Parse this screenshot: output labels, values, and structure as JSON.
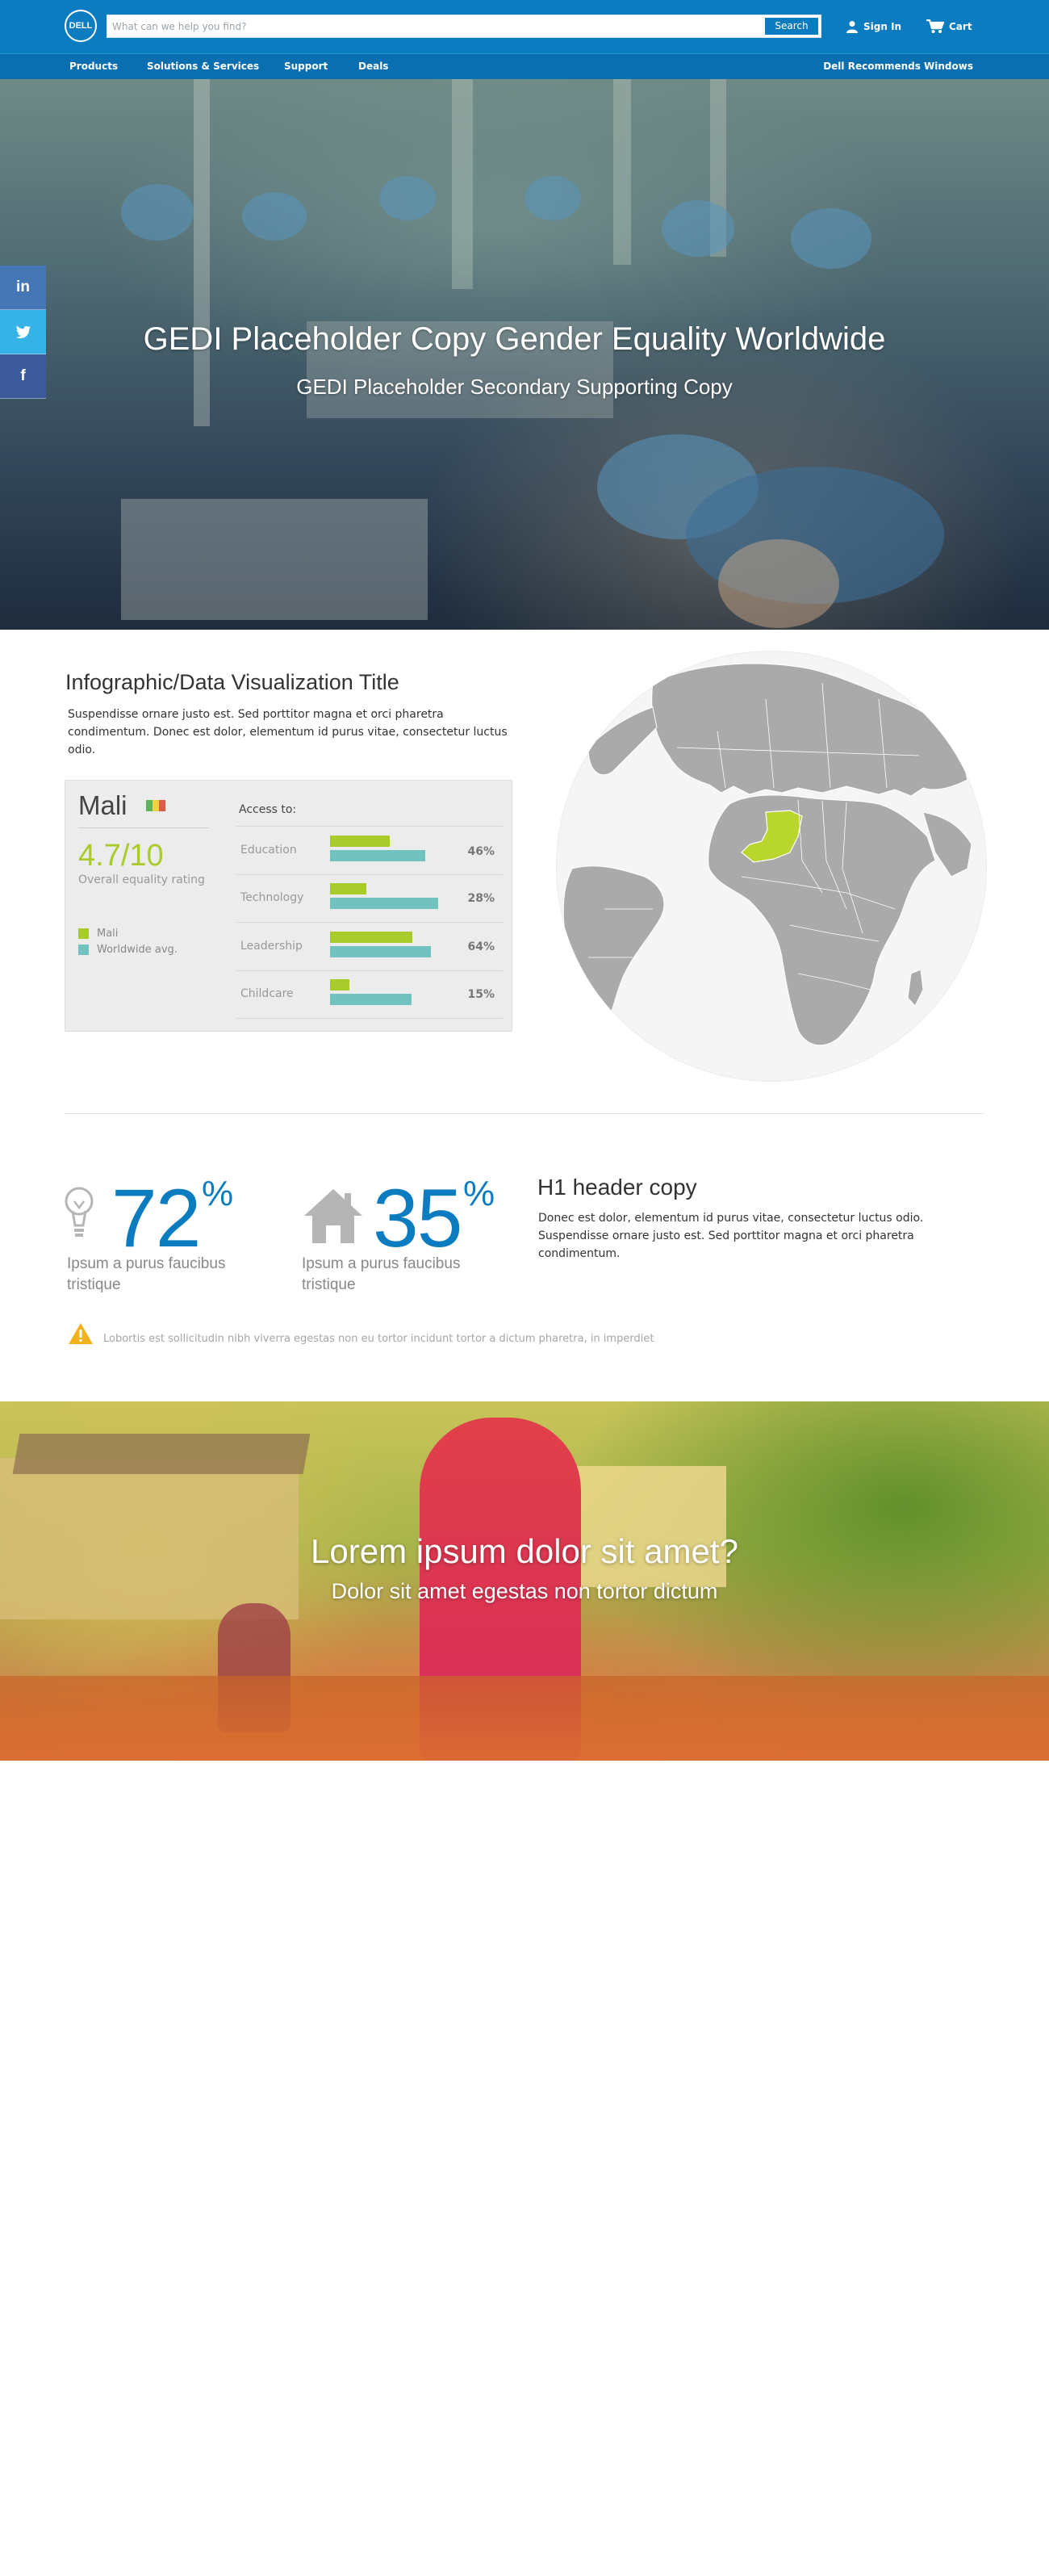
{
  "header": {
    "logo_text": "DELL",
    "search_placeholder": "What can we help you find?",
    "search_button": "Search",
    "sign_in": "Sign In",
    "cart": "Cart",
    "brand_color": "#0c7cc0"
  },
  "nav": {
    "items": [
      "Products",
      "Solutions & Services",
      "Support",
      "Deals"
    ],
    "right": "Dell Recommends Windows"
  },
  "hero": {
    "title": "GEDI Placeholder Copy Gender Equality Worldwide",
    "subtitle": "GEDI Placeholder Secondary Supporting Copy"
  },
  "share": {
    "linkedin": "in",
    "twitter": "twitter-icon",
    "facebook": "f",
    "colors": {
      "linkedin": "#4577b4",
      "twitter": "#36b3e6",
      "facebook": "#3d5a9a"
    }
  },
  "infographic": {
    "title": "Infographic/Data Visualization Title",
    "description": "Suspendisse ornare justo est. Sed porttitor magna et orci pharetra condimentum. Donec est dolor, elementum id purus vitae, consectetur luctus odio.",
    "country": "Mali",
    "rating": "4.7/10",
    "rating_label": "Overall equality rating",
    "legend": [
      {
        "label": "Mali",
        "color": "#a9cb2b"
      },
      {
        "label": "Worldwide avg.",
        "color": "#72c3c0"
      }
    ],
    "access_label": "Access to:"
  },
  "chart_data": {
    "type": "bar",
    "categories": [
      "Education",
      "Technology",
      "Leadership",
      "Childcare"
    ],
    "series": [
      {
        "name": "Mali",
        "values": [
          46,
          28,
          64,
          15
        ],
        "color": "#a9cb2b"
      },
      {
        "name": "Worldwide avg.",
        "values": [
          74,
          84,
          78,
          63
        ],
        "color": "#72c3c0"
      }
    ],
    "value_labels": [
      "46%",
      "28%",
      "64%",
      "15%"
    ],
    "ylim": [
      0,
      100
    ]
  },
  "stats": [
    {
      "value": "72",
      "unit": "%",
      "caption": "Ipsum a purus faucibus tristique",
      "icon": "lightbulb-icon"
    },
    {
      "value": "35",
      "unit": "%",
      "caption": "Ipsum a purus faucibus tristique",
      "icon": "house-icon"
    }
  ],
  "h1": {
    "title": "H1 header copy",
    "body": "Donec est dolor, elementum id purus vitae, consectetur luctus odio. Suspendisse ornare justo est. Sed porttitor magna et orci pharetra condimentum."
  },
  "warning": {
    "icon": "warning-icon",
    "text": "Lobortis est sollicitudin nibh viverra egestas non eu tortor incidunt tortor a dictum pharetra, in imperdiet"
  },
  "hero2": {
    "title": "Lorem ipsum dolor sit amet?",
    "subtitle": "Dolor sit amet egestas non tortor dictum"
  }
}
